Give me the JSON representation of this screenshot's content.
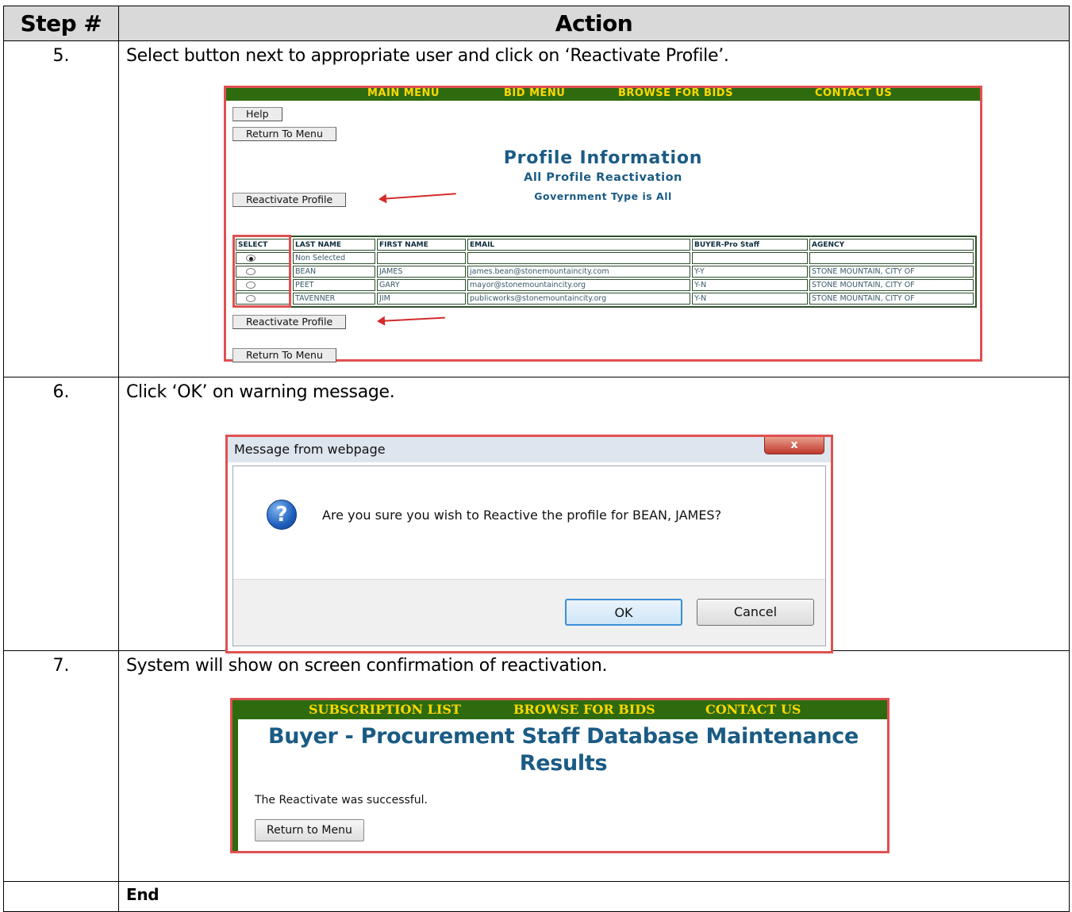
{
  "header": {
    "step_label": "Step #",
    "action_label": "Action"
  },
  "steps": [
    {
      "num": "5.",
      "text": "Select button next to appropriate user and click on ‘Reactivate Profile’."
    },
    {
      "num": "6.",
      "text": "Click ‘OK’ on warning message."
    },
    {
      "num": "7.",
      "text": "System will show on screen confirmation of reactivation."
    },
    {
      "num": "",
      "text": "End"
    }
  ],
  "screen1": {
    "nav": [
      "MAIN MENU",
      "BID MENU",
      "BROWSE FOR BIDS",
      "CONTACT US"
    ],
    "help_button": "Help",
    "return_button": "Return To Menu",
    "title": "Profile Information",
    "subtitle": "All Profile Reactivation",
    "subtitle2": "Government Type is All",
    "reactivate_button": "Reactivate Profile",
    "columns": [
      "SELECT",
      "LAST NAME",
      "FIRST NAME",
      "EMAIL",
      "BUYER-Pro Staff",
      "AGENCY"
    ],
    "rows": [
      {
        "last": "Non Selected",
        "first": "",
        "email": "",
        "buyer": "",
        "agency": "",
        "selected": true
      },
      {
        "last": "BEAN",
        "first": "JAMES",
        "email": "james.bean@stonemountaincity.com",
        "buyer": "Y-Y",
        "agency": "STONE MOUNTAIN, CITY OF",
        "selected": false
      },
      {
        "last": "PEET",
        "first": "GARY",
        "email": "mayor@stonemountaincity.org",
        "buyer": "Y-N",
        "agency": "STONE MOUNTAIN, CITY OF",
        "selected": false
      },
      {
        "last": "TAVENNER",
        "first": "JIM",
        "email": "publicworks@stonemountaincity.org",
        "buyer": "Y-N",
        "agency": "STONE MOUNTAIN, CITY OF",
        "selected": false
      }
    ]
  },
  "screen2": {
    "title": "Message from webpage",
    "close": "x",
    "icon": "?",
    "message": "Are you sure you wish to Reactive the profile for BEAN, JAMES?",
    "ok": "OK",
    "cancel": "Cancel"
  },
  "screen3": {
    "nav": [
      "SUBSCRIPTION LIST",
      "BROWSE FOR BIDS",
      "CONTACT US"
    ],
    "title_line1": "Buyer - Procurement Staff Database Maintenance",
    "title_line2": "Results",
    "message": "The Reactivate was successful.",
    "return_button": "Return to Menu"
  }
}
